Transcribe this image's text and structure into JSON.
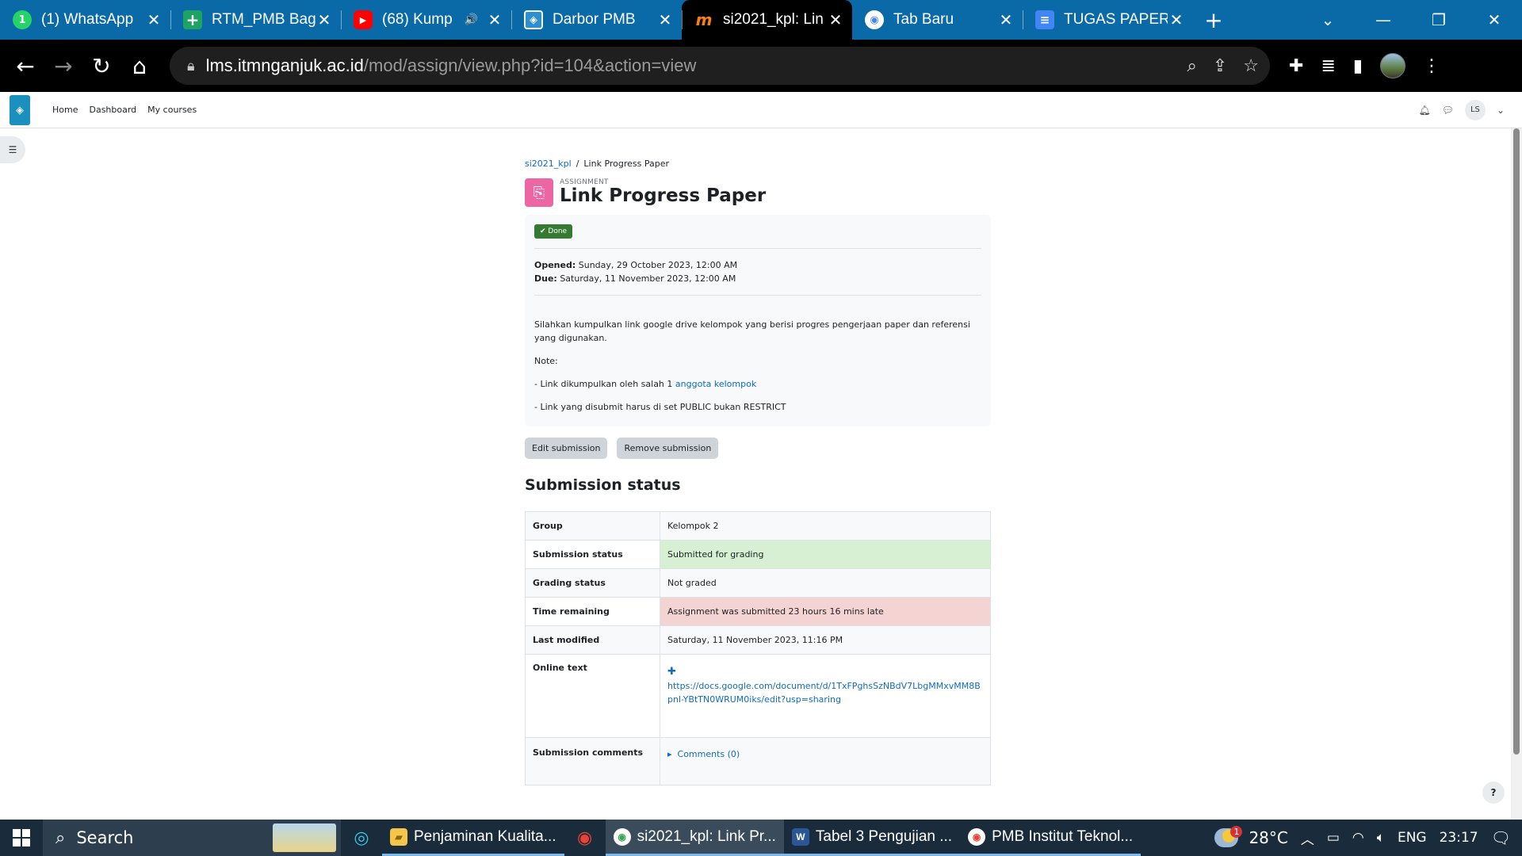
{
  "browser": {
    "tabs": [
      {
        "title": "(1) WhatsApp",
        "icon": "whatsapp-icon",
        "fav": "1"
      },
      {
        "title": "RTM_PMB Bag",
        "icon": "sheets-icon",
        "fav": "+"
      },
      {
        "title": "(68) Kump",
        "icon": "youtube-icon",
        "fav": "▶",
        "audio": "🔊"
      },
      {
        "title": "Darbor PMB",
        "icon": "darbor-icon",
        "fav": "◈"
      },
      {
        "title": "si2021_kpl: Lin",
        "icon": "moodle-icon",
        "fav": "m"
      },
      {
        "title": "Tab Baru",
        "icon": "chrome-icon",
        "fav": "◉"
      },
      {
        "title": "TUGAS PAPER",
        "icon": "docs-icon",
        "fav": "≡"
      }
    ],
    "close_glyph": "✕",
    "new_tab_glyph": "+",
    "url_host": "lms.itmnganjuk.ac.id",
    "url_path": "/mod/assign/view.php?id=104&action=view"
  },
  "lms": {
    "nav": [
      "Home",
      "Dashboard",
      "My courses"
    ],
    "user_initials": "LS"
  },
  "page": {
    "breadcrumb": [
      "si2021_kpl",
      "Link Progress Paper"
    ],
    "breadcrumb_sep": "/",
    "pretitle": "ASSIGNMENT",
    "title": "Link Progress Paper",
    "done_label": "Done",
    "opened_label": "Opened:",
    "opened_value": "Sunday, 29 October 2023, 12:00 AM",
    "due_label": "Due:",
    "due_value": "Saturday, 11 November 2023, 12:00 AM",
    "intro_1": "Silahkan kumpulkan link google drive kelompok yang berisi progres pengerjaan paper dan referensi yang digunakan.",
    "intro_note": "Note:",
    "intro_2a": "- Link dikumpulkan oleh salah 1 ",
    "intro_2b": "anggota kelompok",
    "intro_3": "- Link yang disubmit harus di set PUBLIC bukan RESTRICT",
    "edit_button": "Edit submission",
    "remove_button": "Remove submission",
    "submission_heading": "Submission status",
    "status_rows": [
      {
        "label": "Group",
        "value": "Kelompok 2"
      },
      {
        "label": "Submission status",
        "value": "Submitted for grading"
      },
      {
        "label": "Grading status",
        "value": "Not graded"
      },
      {
        "label": "Time remaining",
        "value": "Assignment was submitted 23 hours 16 mins late"
      },
      {
        "label": "Last modified",
        "value": "Saturday, 11 November 2023, 11:16 PM"
      },
      {
        "label": "Online text",
        "value": "https://docs.google.com/document/d/1TxFPghsSzNBdV7LbgMMxvMM8Bpnl-YBtTN0WRUM0iks/edit?usp=sharing"
      },
      {
        "label": "Submission comments",
        "value": "Comments (0)"
      }
    ],
    "help": "?"
  },
  "taskbar": {
    "search": "Search",
    "apps": [
      {
        "title": "Penjaminan Kualita...",
        "icon": "folder-icon"
      },
      {
        "title": "si2021_kpl: Link Pr...",
        "icon": "chrome-icon"
      },
      {
        "title": "Tabel 3 Pengujian ...",
        "icon": "word-icon"
      },
      {
        "title": "PMB Institut Teknol...",
        "icon": "chrome-icon"
      }
    ],
    "temperature": "28°C",
    "weather_badge": "1",
    "lang": "ENG",
    "time": "23:17"
  },
  "colors": {
    "tabstrip": "#0a6aa8",
    "moodle_link": "#0f6cbf",
    "done_badge": "#357a32",
    "submitted_bg": "#d7f0d3",
    "late_bg": "#f4d3d3",
    "assignment_icon": "#eb66a2"
  }
}
